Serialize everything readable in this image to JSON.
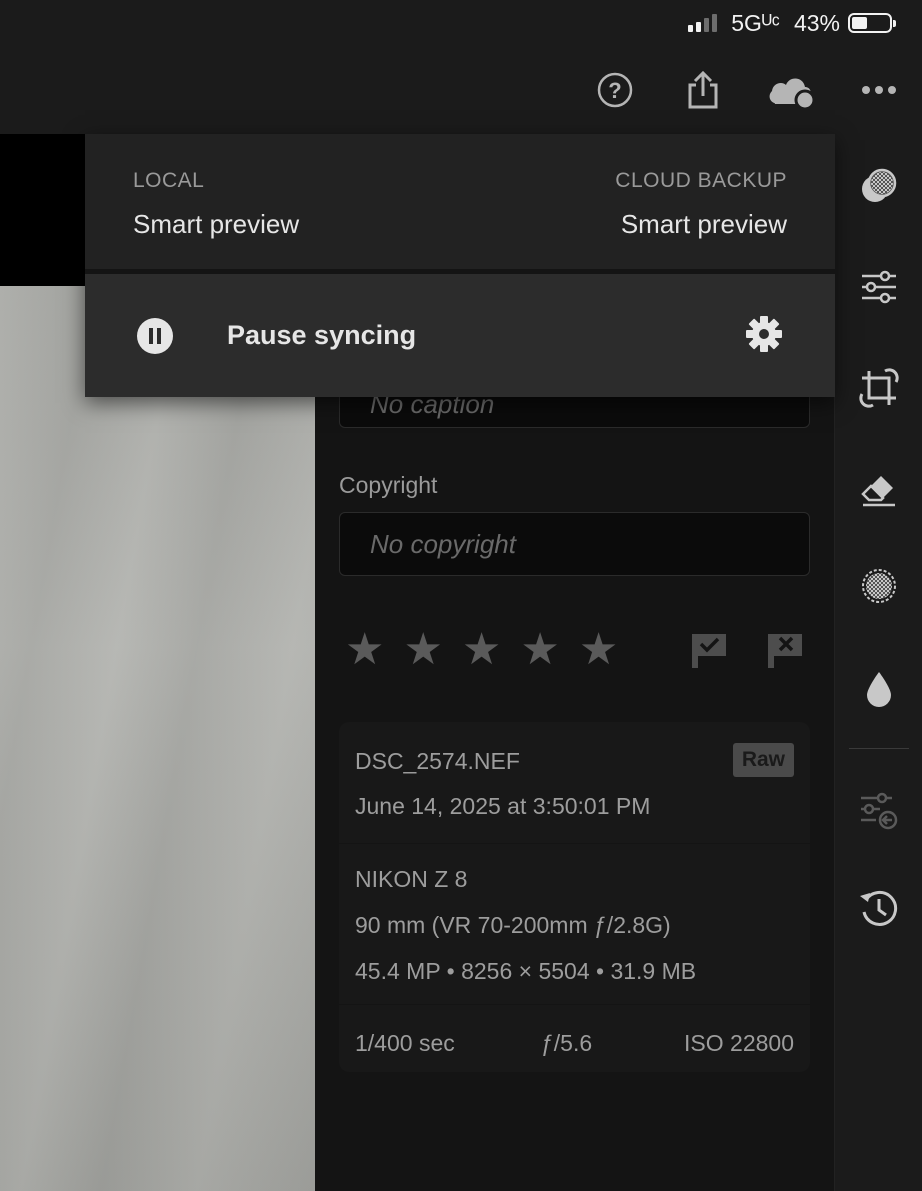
{
  "status_bar": {
    "network": "5Gᵁᶜ",
    "battery": "43%",
    "battery_level": 0.43
  },
  "top_bar": {
    "icons": [
      "help-icon",
      "share-icon",
      "cloud-sync-icon",
      "more-icon"
    ]
  },
  "popover": {
    "local_caption": "LOCAL",
    "local_value": "Smart preview",
    "cloud_caption": "CLOUD BACKUP",
    "cloud_value": "Smart preview",
    "pause_label": "Pause syncing"
  },
  "info_panel": {
    "caption_placeholder": "No caption",
    "copyright_label": "Copyright",
    "copyright_placeholder": "No copyright",
    "rating": 0,
    "rating_max": 5,
    "file": {
      "name": "DSC_2574.NEF",
      "badge": "Raw",
      "date": "June 14, 2025 at 3:50:01 PM"
    },
    "camera": {
      "model": "NIKON Z 8",
      "lens": "90 mm (VR 70-200mm ƒ/2.8G)",
      "specs": "45.4 MP • 8256 × 5504 • 31.9 MB"
    },
    "exposure": {
      "shutter": "1/400 sec",
      "aperture": "ƒ/5.6",
      "iso": "ISO 22800"
    }
  },
  "toolbar": {
    "icons": [
      "presets-icon",
      "edit-sliders-icon",
      "crop-icon",
      "healing-icon",
      "masking-icon",
      "blur-icon",
      "versions-icon",
      "history-icon"
    ]
  },
  "colors": {
    "background": "#141414",
    "bar": "#1b1b1b",
    "popover": "#232323",
    "popover_action": "#2c2c2c"
  }
}
